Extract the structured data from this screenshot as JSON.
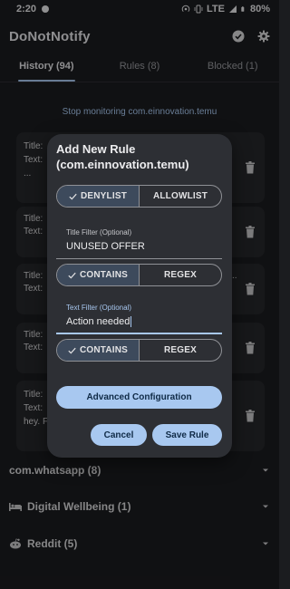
{
  "status_bar": {
    "time": "2:20",
    "network": "LTE",
    "battery": "80%"
  },
  "app": {
    "title": "DoNotNotify"
  },
  "tabs": [
    {
      "label": "History (94)",
      "active": true
    },
    {
      "label": "Rules (8)",
      "active": false
    },
    {
      "label": "Blocked (1)",
      "active": false
    }
  ],
  "history": {
    "stop_monitoring": "Stop monitoring com.einnovation.temu",
    "cards": [
      {
        "lines": [
          "Title:",
          "Text:",
          "..."
        ]
      },
      {
        "lines": [
          "Title:",
          "Text:"
        ]
      },
      {
        "lines": [
          "Title:",
          "Text:"
        ],
        "trail": ".."
      },
      {
        "lines": [
          "Title:",
          "Text:"
        ]
      },
      {
        "lines": [
          "Title:",
          "Text:",
          "hey. F"
        ]
      }
    ],
    "groups": [
      {
        "label": "com.whatsapp (8)",
        "icon": ""
      },
      {
        "label": "Digital Wellbeing (1)",
        "icon": "bed-icon"
      },
      {
        "label": "Reddit (5)",
        "icon": "reddit-icon"
      }
    ]
  },
  "dialog": {
    "title": "Add New Rule (com.einnovation.temu)",
    "mode": {
      "options": [
        "DENYLIST",
        "ALLOWLIST"
      ],
      "selected": "DENYLIST"
    },
    "title_filter": {
      "label": "Title Filter (Optional)",
      "value": "UNUSED OFFER"
    },
    "title_match": {
      "options": [
        "CONTAINS",
        "REGEX"
      ],
      "selected": "CONTAINS"
    },
    "text_filter": {
      "label": "Text Filter (Optional)",
      "value": "Action needed"
    },
    "text_match": {
      "options": [
        "CONTAINS",
        "REGEX"
      ],
      "selected": "CONTAINS"
    },
    "advanced_label": "Advanced Configuration",
    "cancel_label": "Cancel",
    "save_label": "Save Rule"
  },
  "colors": {
    "accent": "#a8c8f0",
    "background": "#1b1c1f",
    "dialog": "#2d2f34",
    "selected_segment": "#3d4a5c"
  }
}
